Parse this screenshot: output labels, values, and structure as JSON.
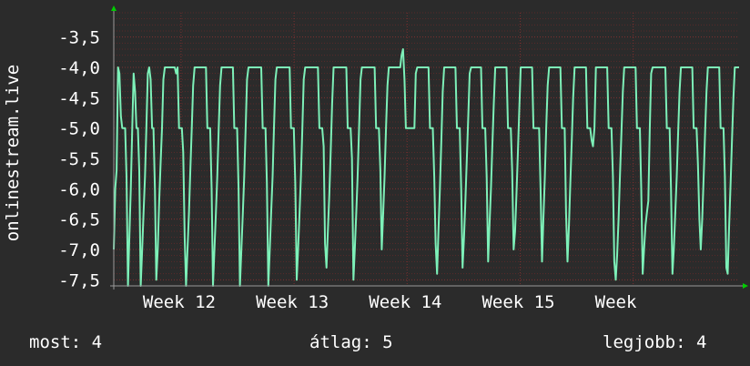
{
  "colors": {
    "background": "#2b2b2b",
    "plot_background": "#2b2b2b",
    "grid_minor": "#5a2a2a",
    "grid_major": "#7a3030",
    "series": "#7df0b8",
    "axis_arrow": "#00cc00",
    "text": "#ffffff"
  },
  "chart_data": {
    "type": "line",
    "title": "",
    "ylabel": "onlinestream.live",
    "xlabel": "",
    "ylim": [
      -7.6,
      -3.1
    ],
    "yticks": [
      {
        "value": -3.5,
        "label": "-3,5"
      },
      {
        "value": -4.0,
        "label": "-4,0"
      },
      {
        "value": -4.5,
        "label": "-4,5"
      },
      {
        "value": -5.0,
        "label": "-5,0"
      },
      {
        "value": -5.5,
        "label": "-5,5"
      },
      {
        "value": -6.0,
        "label": "-6,0"
      },
      {
        "value": -6.5,
        "label": "-6,5"
      },
      {
        "value": -7.0,
        "label": "-7,0"
      },
      {
        "value": -7.5,
        "label": "-7,5"
      }
    ],
    "xlim": [
      0,
      437
    ],
    "xticks": [
      {
        "value": 47,
        "label": "Week 12"
      },
      {
        "value": 126,
        "label": "Week 13"
      },
      {
        "value": 205,
        "label": "Week 14"
      },
      {
        "value": 284,
        "label": "Week 15"
      },
      {
        "value": 363,
        "label": "Week"
      }
    ],
    "grid": true,
    "series": [
      {
        "values": [
          -7.0,
          -6.0,
          -5.7,
          -4.0,
          -4.1,
          -4.8,
          -5.0,
          -5.0,
          -5.0,
          -5.8,
          -7.6,
          -6.8,
          -6.0,
          -5.0,
          -4.1,
          -4.4,
          -5.0,
          -5.0,
          -5.7,
          -7.6,
          -7.0,
          -6.4,
          -5.8,
          -5.0,
          -4.1,
          -4.0,
          -4.2,
          -5.0,
          -5.0,
          -6.0,
          -7.5,
          -7.0,
          -6.2,
          -5.6,
          -5.0,
          -4.2,
          -4.0,
          -4.0,
          -4.0,
          -4.0,
          -4.0,
          -4.0,
          -4.0,
          -4.0,
          -4.1,
          -4.0,
          -5.0,
          -5.0,
          -5.0,
          -5.4,
          -6.8,
          -7.6,
          -7.0,
          -6.4,
          -5.7,
          -5.0,
          -4.3,
          -4.0,
          -4.0,
          -4.0,
          -4.0,
          -4.0,
          -4.0,
          -4.0,
          -4.0,
          -4.0,
          -5.0,
          -5.0,
          -5.0,
          -6.0,
          -7.6,
          -7.0,
          -6.4,
          -5.8,
          -5.0,
          -4.3,
          -4.0,
          -4.0,
          -4.0,
          -4.0,
          -4.0,
          -4.0,
          -4.0,
          -4.0,
          -4.0,
          -5.0,
          -5.0,
          -5.0,
          -6.0,
          -7.6,
          -7.0,
          -6.4,
          -5.8,
          -5.0,
          -4.2,
          -4.0,
          -4.0,
          -4.0,
          -4.0,
          -4.0,
          -4.0,
          -4.0,
          -4.0,
          -4.0,
          -4.0,
          -5.0,
          -5.0,
          -5.0,
          -5.9,
          -7.6,
          -7.0,
          -6.4,
          -5.8,
          -5.0,
          -4.2,
          -4.0,
          -4.0,
          -4.0,
          -4.0,
          -4.0,
          -4.0,
          -4.0,
          -4.0,
          -4.0,
          -4.0,
          -5.0,
          -5.0,
          -5.0,
          -5.9,
          -7.5,
          -7.0,
          -6.4,
          -5.8,
          -5.0,
          -4.2,
          -4.0,
          -4.0,
          -4.0,
          -4.0,
          -4.0,
          -4.0,
          -4.0,
          -4.0,
          -4.0,
          -4.0,
          -5.0,
          -5.0,
          -5.0,
          -5.3,
          -6.9,
          -7.3,
          -6.7,
          -6.1,
          -5.4,
          -4.6,
          -4.0,
          -4.0,
          -4.0,
          -4.0,
          -4.0,
          -4.0,
          -4.0,
          -4.0,
          -4.0,
          -4.0,
          -5.0,
          -5.0,
          -5.0,
          -5.5,
          -7.5,
          -7.0,
          -6.4,
          -5.8,
          -5.0,
          -4.2,
          -4.0,
          -4.0,
          -4.0,
          -4.0,
          -4.0,
          -4.0,
          -4.0,
          -4.0,
          -4.0,
          -4.0,
          -5.0,
          -5.0,
          -5.0,
          -5.7,
          -7.0,
          -6.4,
          -5.8,
          -5.0,
          -4.3,
          -4.0,
          -4.0,
          -4.0,
          -4.0,
          -4.0,
          -4.0,
          -4.0,
          -4.0,
          -4.0,
          -3.8,
          -3.7,
          -4.2,
          -5.0,
          -5.0,
          -5.0,
          -5.0,
          -5.0,
          -5.0,
          -5.0,
          -4.1,
          -4.0,
          -4.0,
          -4.0,
          -4.0,
          -4.0,
          -4.0,
          -4.0,
          -4.0,
          -4.0,
          -5.0,
          -5.0,
          -5.0,
          -5.8,
          -6.9,
          -7.4,
          -6.7,
          -6.0,
          -5.2,
          -4.4,
          -4.0,
          -4.0,
          -4.0,
          -4.0,
          -4.0,
          -4.0,
          -4.0,
          -4.0,
          -4.0,
          -5.0,
          -5.0,
          -5.0,
          -6.0,
          -7.3,
          -6.8,
          -6.2,
          -5.5,
          -4.8,
          -4.1,
          -4.0,
          -4.0,
          -4.0,
          -4.0,
          -4.0,
          -4.0,
          -4.0,
          -4.0,
          -5.0,
          -5.0,
          -5.0,
          -5.8,
          -7.2,
          -6.6,
          -6.0,
          -5.3,
          -4.6,
          -4.0,
          -4.0,
          -4.0,
          -4.0,
          -4.0,
          -4.0,
          -4.0,
          -4.0,
          -4.0,
          -5.0,
          -5.0,
          -5.0,
          -5.7,
          -7.0,
          -6.7,
          -6.1,
          -5.4,
          -4.7,
          -4.0,
          -4.0,
          -4.0,
          -4.0,
          -4.0,
          -4.0,
          -4.0,
          -4.0,
          -4.0,
          -5.0,
          -5.0,
          -5.0,
          -5.0,
          -5.0,
          -6.0,
          -7.2,
          -6.5,
          -5.8,
          -5.0,
          -4.3,
          -4.0,
          -4.0,
          -4.0,
          -4.0,
          -4.0,
          -4.0,
          -4.0,
          -4.0,
          -4.0,
          -5.0,
          -5.0,
          -5.0,
          -6.4,
          -7.2,
          -6.6,
          -5.9,
          -5.2,
          -4.5,
          -4.0,
          -4.0,
          -4.0,
          -4.0,
          -4.0,
          -4.0,
          -4.0,
          -4.0,
          -4.0,
          -5.0,
          -5.0,
          -5.0,
          -5.2,
          -5.3,
          -5.0,
          -4.0,
          -4.0,
          -4.0,
          -4.0,
          -4.0,
          -4.0,
          -4.0,
          -4.0,
          -4.0,
          -5.0,
          -5.0,
          -5.0,
          -5.8,
          -7.2,
          -7.5,
          -7.1,
          -6.5,
          -5.8,
          -5.1,
          -4.4,
          -4.0,
          -4.0,
          -4.0,
          -4.0,
          -4.0,
          -4.0,
          -4.0,
          -4.0,
          -4.0,
          -5.0,
          -5.0,
          -5.0,
          -6.0,
          -7.4,
          -7.0,
          -6.6,
          -6.4,
          -6.2,
          -5.0,
          -4.1,
          -4.0,
          -4.0,
          -4.0,
          -4.0,
          -4.0,
          -4.0,
          -4.0,
          -4.0,
          -4.0,
          -4.0,
          -5.0,
          -5.0,
          -5.0,
          -6.0,
          -7.4,
          -7.0,
          -6.4,
          -5.8,
          -5.1,
          -4.4,
          -4.0,
          -4.0,
          -4.0,
          -4.0,
          -4.0,
          -4.0,
          -4.0,
          -4.0,
          -4.0,
          -5.0,
          -5.0,
          -5.0,
          -5.6,
          -6.5,
          -7.0,
          -6.5,
          -5.8,
          -5.1,
          -4.4,
          -4.0,
          -4.0,
          -4.0,
          -4.0,
          -4.0,
          -4.0,
          -4.0,
          -4.0,
          -4.0,
          -5.0,
          -5.0,
          -5.0,
          -5.8,
          -7.3,
          -7.4,
          -6.6,
          -5.9,
          -5.2,
          -4.5,
          -4.0,
          -4.0,
          -4.0,
          -4.0
        ]
      }
    ]
  },
  "legend": {
    "now": "most: 4",
    "avg": "átlag: 5",
    "max": "legjobb: 4"
  }
}
